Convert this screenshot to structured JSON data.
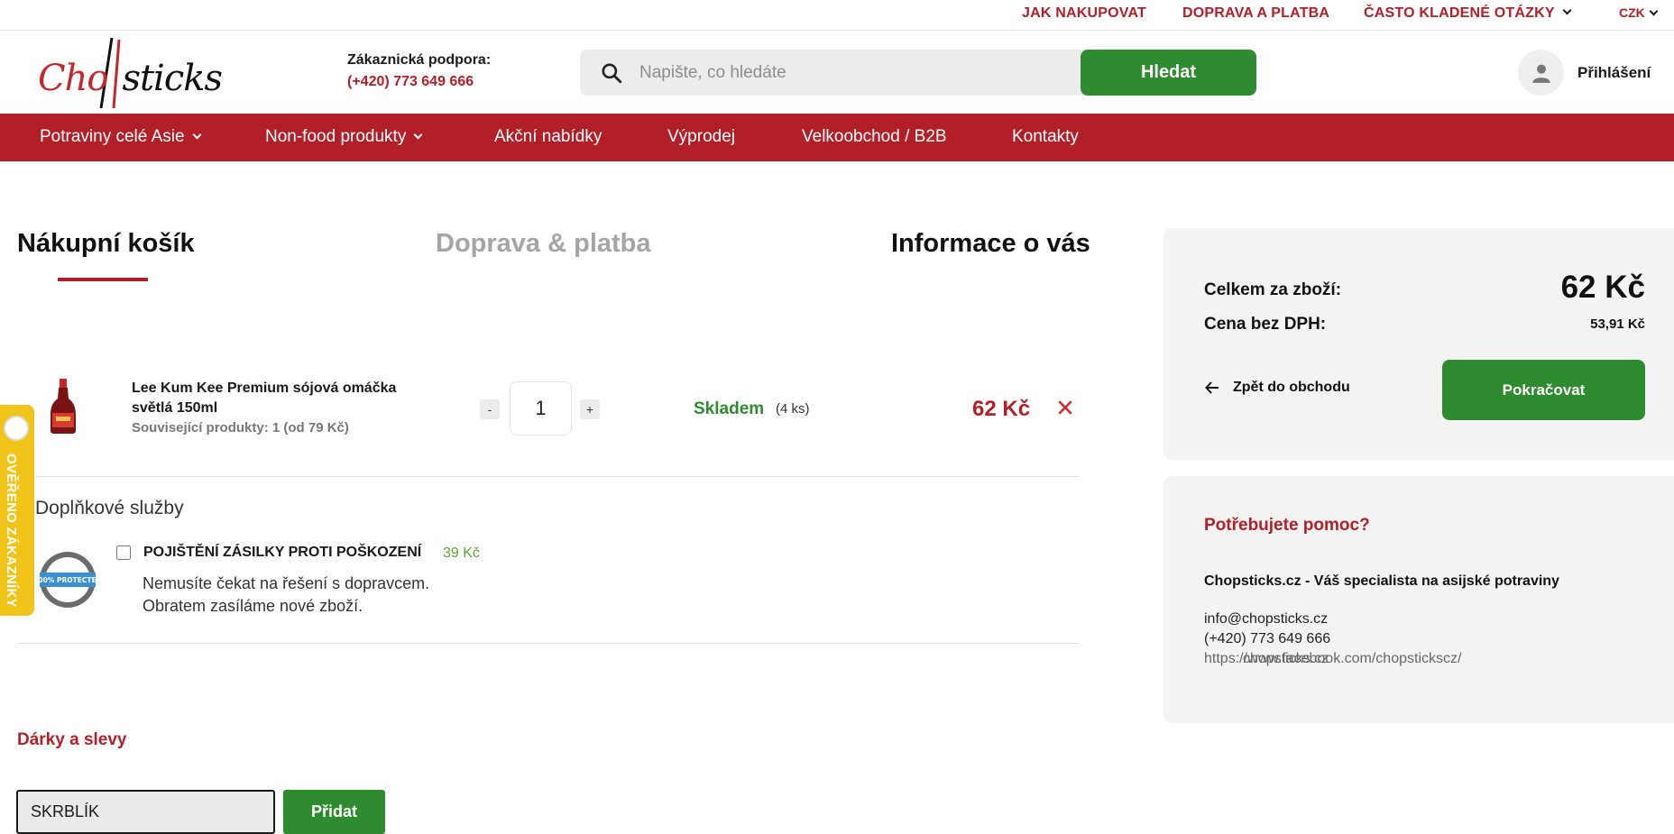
{
  "topbar": {
    "links": [
      "JAK NAKUPOVAT",
      "DOPRAVA A PLATBA",
      "ČASTO KLADENÉ OTÁZKY"
    ],
    "currency": "CZK"
  },
  "header": {
    "logo": {
      "part1": "Cho",
      "part2": "sticks"
    },
    "support_title": "Zákaznická podpora:",
    "support_phone": "(+420) 773 649 666",
    "search_placeholder": "Napište, co hledáte",
    "search_button": "Hledat",
    "login_label": "Přihlášení"
  },
  "nav": {
    "items": [
      "Potraviny celé Asie",
      "Non-food produkty",
      "Akční nabídky",
      "Výprodej",
      "Velkoobchod / B2B",
      "Kontakty"
    ]
  },
  "steps": [
    "Nákupní košík",
    "Doprava & platba",
    "Informace o vás"
  ],
  "cart": {
    "item": {
      "name": "Lee Kum Kee Premium sójová omáčka světlá 150ml",
      "related": "Související produkty: 1 (od 79 Kč)",
      "qty": "1",
      "minus": "-",
      "plus": "+",
      "stock": "Skladem",
      "stock_count": "(4 ks)",
      "price": "62 Kč"
    }
  },
  "services": {
    "title": "Doplňkové služby",
    "insurance_title": "POJIŠTĚNÍ ZÁSILKY PROTI POŠKOZENÍ",
    "insurance_price": "39 Kč",
    "insurance_desc_1": "Nemusíte čekat na řešení s dopravcem.",
    "insurance_desc_2": "Obratem zasíláme nové zboží.",
    "insurance_checked": false,
    "badge_text": "100% PROTECTED"
  },
  "gifts": {
    "title": "Dárky a slevy",
    "coupon_value": "SKRBLÍK",
    "add_button": "Přidat"
  },
  "verified_badge": "OVĚŘENO ZÁKAZNÍKY",
  "summary": {
    "total_label": "Celkem za zboží:",
    "total_value": "62 Kč",
    "net_label": "Cena bez DPH:",
    "net_value": "53,91 Kč",
    "back_label": "Zpět do obchodu",
    "continue_label": "Pokračovat"
  },
  "help": {
    "title": "Potřebujete pomoc?",
    "company": "Chopsticks.cz - Váš specialista na asijské potraviny",
    "email": "info@chopsticks.cz",
    "phone": "(+420) 773 649 666",
    "web": "https://www.facebook.com/chopstickscz/",
    "web_overlay": "chopsticks.cz"
  },
  "colors": {
    "brand_red": "#b21f29",
    "accent_green": "#2e8b30",
    "panel_gray": "#f3f3f3",
    "verified_yellow": "#f0c419"
  }
}
